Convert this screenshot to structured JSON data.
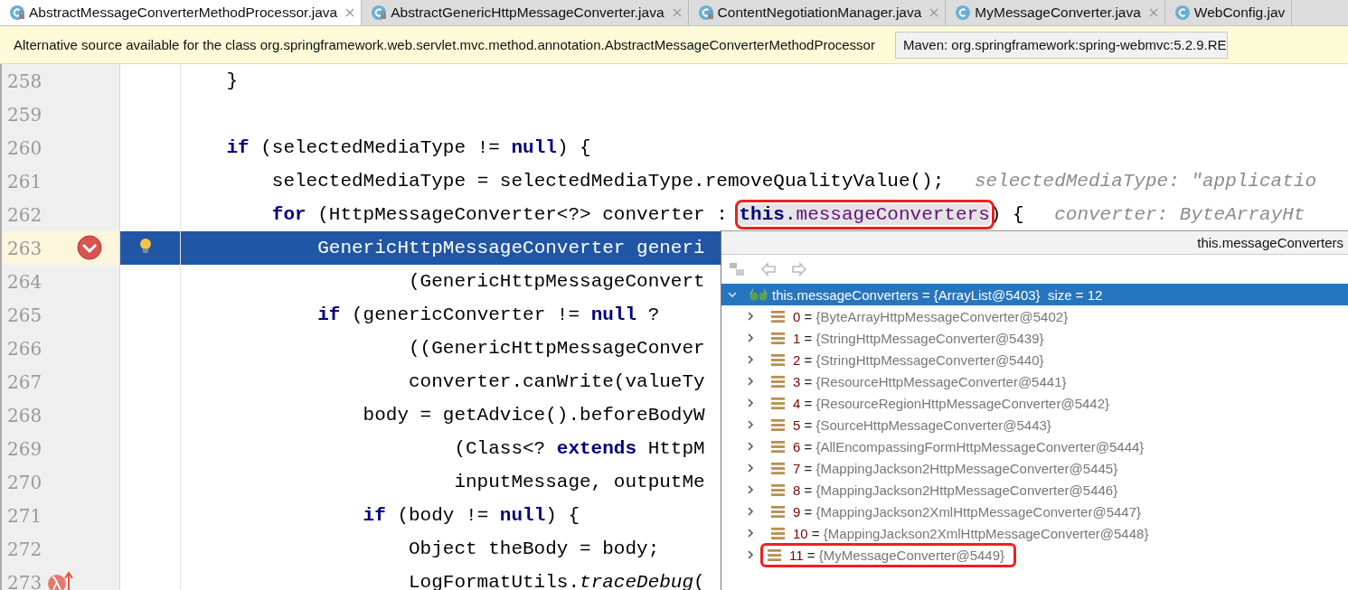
{
  "tabs": [
    {
      "label": "AbstractMessageConverterMethodProcessor.java",
      "selected": true,
      "locked": true,
      "closable": true
    },
    {
      "label": "AbstractGenericHttpMessageConverter.java",
      "selected": false,
      "locked": true,
      "closable": true
    },
    {
      "label": "ContentNegotiationManager.java",
      "selected": false,
      "locked": true,
      "closable": true
    },
    {
      "label": "MyMessageConverter.java",
      "selected": false,
      "locked": false,
      "closable": true
    },
    {
      "label": "WebConfig.jav",
      "selected": false,
      "locked": false,
      "closable": false
    }
  ],
  "banner": {
    "message": "Alternative source available for the class org.springframework.web.servlet.mvc.method.annotation.AbstractMessageConverterMethodProcessor",
    "source_select": "Maven: org.springframework:spring-webmvc:5.2.9.RE"
  },
  "editor": {
    "lines": [
      {
        "number": "258",
        "tokens": [
          {
            "text": "    }",
            "kind": "plain"
          }
        ]
      },
      {
        "number": "259"
      },
      {
        "number": "260",
        "tokens": [
          {
            "text": "    if",
            "kind": "keyword"
          },
          {
            "text": " (selectedMediaType != ",
            "kind": "plain"
          },
          {
            "text": "null",
            "kind": "keyword"
          },
          {
            "text": ") {",
            "kind": "plain"
          }
        ]
      },
      {
        "number": "261",
        "tokens": [
          {
            "text": "        selectedMediaType = selectedMediaType.removeQualityValue();",
            "kind": "plain"
          }
        ],
        "hint": "selectedMediaType: \"applicatio"
      },
      {
        "number": "262",
        "tokens": [
          {
            "text": "        for",
            "kind": "keyword"
          },
          {
            "text": " (HttpMessageConverter<?> converter : ",
            "kind": "plain"
          },
          {
            "kind": "group",
            "marked": true,
            "tokens": [
              {
                "text": "this",
                "kind": "keyword"
              },
              {
                "text": ".",
                "kind": "plain"
              },
              {
                "text": "messageConverters",
                "kind": "field"
              }
            ]
          },
          {
            "text": ") {",
            "kind": "plain"
          }
        ],
        "hint": "converter: ByteArrayHt"
      },
      {
        "number": "263",
        "current": true,
        "breakpoint": true,
        "bulb": true,
        "tokens": [
          {
            "text": "            GenericHttpMessageConverter generi",
            "kind": "plain"
          }
        ]
      },
      {
        "number": "264",
        "tokens": [
          {
            "text": "                    (GenericHttpMessageConvert",
            "kind": "plain"
          }
        ]
      },
      {
        "number": "265",
        "tokens": [
          {
            "text": "            if",
            "kind": "keyword"
          },
          {
            "text": " (genericConverter != ",
            "kind": "plain"
          },
          {
            "text": "null",
            "kind": "keyword"
          },
          {
            "text": " ?",
            "kind": "plain"
          }
        ]
      },
      {
        "number": "266",
        "tokens": [
          {
            "text": "                    ((GenericHttpMessageConver",
            "kind": "plain"
          }
        ]
      },
      {
        "number": "267",
        "tokens": [
          {
            "text": "                    converter.canWrite(valueTy",
            "kind": "plain"
          }
        ]
      },
      {
        "number": "268",
        "tokens": [
          {
            "text": "                body = getAdvice().beforeBodyW",
            "kind": "plain"
          }
        ]
      },
      {
        "number": "269",
        "tokens": [
          {
            "text": "                        (Class<? ",
            "kind": "plain"
          },
          {
            "text": "extends",
            "kind": "keyword"
          },
          {
            "text": " HttpM",
            "kind": "plain"
          }
        ]
      },
      {
        "number": "270",
        "tokens": [
          {
            "text": "                        inputMessage, outputMe",
            "kind": "plain"
          }
        ]
      },
      {
        "number": "271",
        "tokens": [
          {
            "text": "                if",
            "kind": "keyword"
          },
          {
            "text": " (body != ",
            "kind": "plain"
          },
          {
            "text": "null",
            "kind": "keyword"
          },
          {
            "text": ") {",
            "kind": "plain"
          }
        ]
      },
      {
        "number": "272",
        "tokens": [
          {
            "text": "                    Object theBody = body;",
            "kind": "plain"
          }
        ]
      },
      {
        "number": "273",
        "lambda_breakpoint": true,
        "tokens": [
          {
            "text": "                    LogFormatUtils.",
            "kind": "plain"
          },
          {
            "text": "traceDebug",
            "kind": "static"
          },
          {
            "text": "(",
            "kind": "plain"
          }
        ]
      }
    ]
  },
  "popup": {
    "title": "this.messageConverters",
    "root": {
      "label": "this.messageConverters = {ArrayList@5403}  size = 12",
      "expanded": true,
      "selected": true
    },
    "items": [
      {
        "name": "0",
        "operator": "=",
        "value": "{ByteArrayHttpMessageConverter@5402}",
        "expanded": false,
        "marked": false
      },
      {
        "name": "1",
        "operator": "=",
        "value": "{StringHttpMessageConverter@5439}",
        "expanded": false,
        "marked": false
      },
      {
        "name": "2",
        "operator": "=",
        "value": "{StringHttpMessageConverter@5440}",
        "expanded": false,
        "marked": false
      },
      {
        "name": "3",
        "operator": "=",
        "value": "{ResourceHttpMessageConverter@5441}",
        "expanded": false,
        "marked": false
      },
      {
        "name": "4",
        "operator": "=",
        "value": "{ResourceRegionHttpMessageConverter@5442}",
        "expanded": false,
        "marked": false
      },
      {
        "name": "5",
        "operator": "=",
        "value": "{SourceHttpMessageConverter@5443}",
        "expanded": false,
        "marked": false
      },
      {
        "name": "6",
        "operator": "=",
        "value": "{AllEncompassingFormHttpMessageConverter@5444}",
        "expanded": false,
        "marked": false
      },
      {
        "name": "7",
        "operator": "=",
        "value": "{MappingJackson2HttpMessageConverter@5445}",
        "expanded": false,
        "marked": false
      },
      {
        "name": "8",
        "operator": "=",
        "value": "{MappingJackson2HttpMessageConverter@5446}",
        "expanded": false,
        "marked": false
      },
      {
        "name": "9",
        "operator": "=",
        "value": "{MappingJackson2XmlHttpMessageConverter@5447}",
        "expanded": false,
        "marked": false
      },
      {
        "name": "10",
        "operator": "=",
        "value": "{MappingJackson2XmlHttpMessageConverter@5448}",
        "expanded": false,
        "marked": false
      },
      {
        "name": "11",
        "operator": "=",
        "value": "{MyMessageConverter@5449}",
        "expanded": false,
        "marked": true
      }
    ]
  }
}
